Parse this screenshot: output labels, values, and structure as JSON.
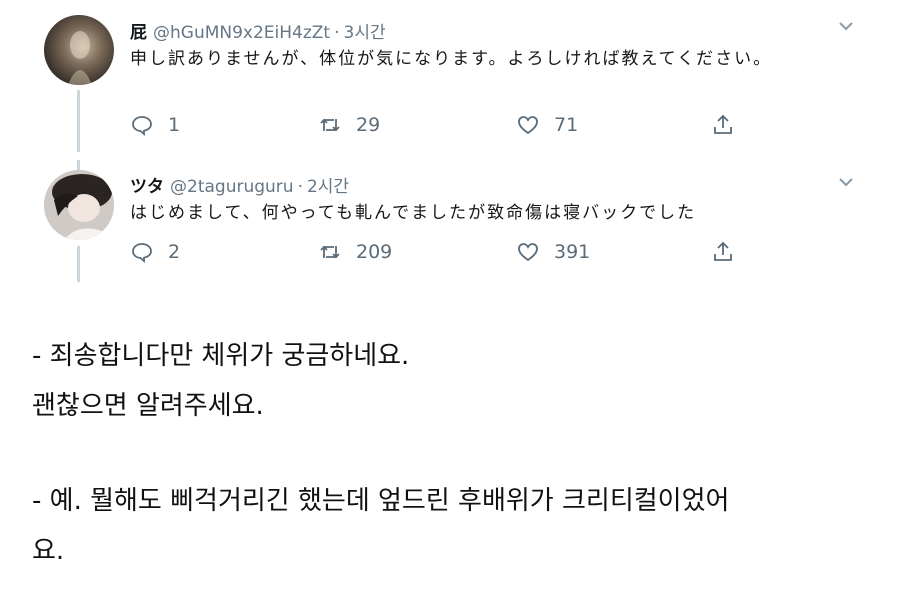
{
  "tweets": [
    {
      "name": "屁",
      "handle": "@hGuMN9x2EiH4zZt",
      "time": "3시간",
      "text": "申し訳ありませんが、体位が気になります。よろしければ教えてください。",
      "reply_count": "1",
      "retweet_count": "29",
      "like_count": "71"
    },
    {
      "name": "ツタ",
      "handle": "@2taguruguru",
      "time": "2시간",
      "text": "はじめまして、何やっても軋んでましたが致命傷は寝バックでした",
      "reply_count": "2",
      "retweet_count": "209",
      "like_count": "391"
    }
  ],
  "captions": {
    "q_line1": "- 죄송합니다만 체위가 궁금하네요.",
    "q_line2": "괜찮으면 알려주세요.",
    "a_line1": "- 예. 뭘해도 삐걱거리긴 했는데 엎드린 후배위가 크리티컬이었어",
    "a_line2": "요."
  },
  "icons": [
    "reply-icon",
    "retweet-icon",
    "like-icon",
    "share-icon",
    "chevron-down-icon"
  ],
  "colors": {
    "meta_text": "#657786",
    "icon": "#5b6b78",
    "thread_line": "#ccd6dd"
  }
}
